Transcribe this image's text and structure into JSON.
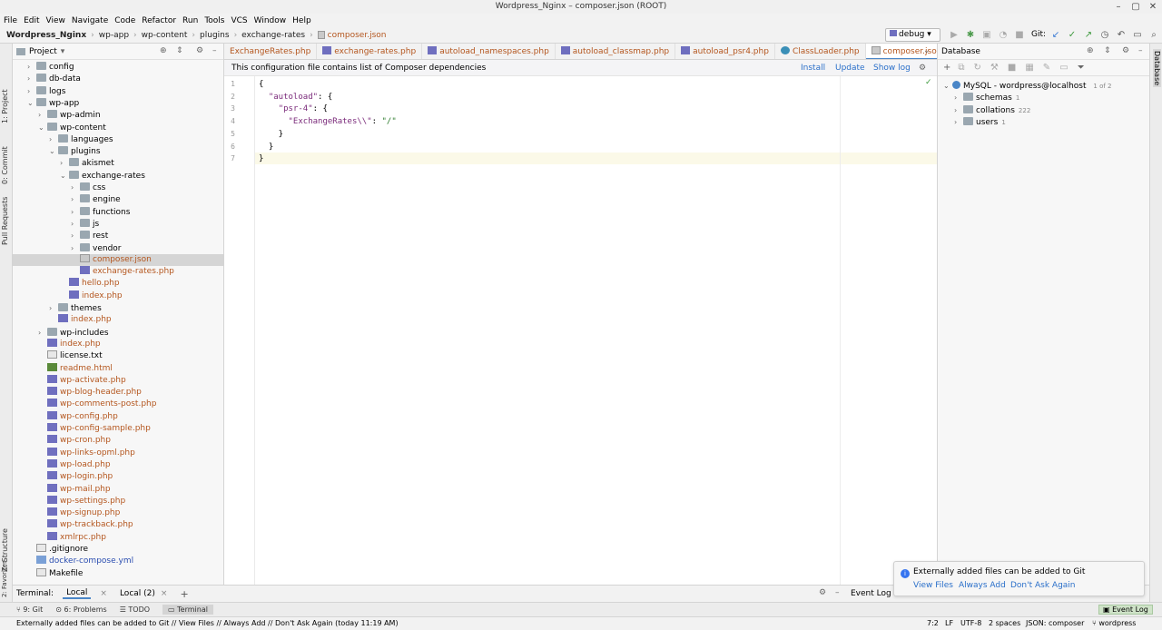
{
  "window": {
    "title": "Wordpress_Nginx – composer.json (ROOT)"
  },
  "menu": [
    "File",
    "Edit",
    "View",
    "Navigate",
    "Code",
    "Refactor",
    "Run",
    "Tools",
    "VCS",
    "Window",
    "Help"
  ],
  "breadcrumb": [
    "Wordpress_Nginx",
    "wp-app",
    "wp-content",
    "plugins",
    "exchange-rates",
    "composer.json"
  ],
  "toolbar": {
    "run_config": "debug",
    "git_label": "Git:"
  },
  "left_tabs": [
    "1: Project",
    "0: Commit",
    "Pull Requests",
    "Z: Structure",
    "2: Favorites"
  ],
  "right_tabs": [
    "Database"
  ],
  "project": {
    "title": "Project",
    "tree": [
      {
        "label": "config",
        "depth": 1,
        "type": "folder",
        "arrow": "›"
      },
      {
        "label": "db-data",
        "depth": 1,
        "type": "folder",
        "arrow": "›"
      },
      {
        "label": "logs",
        "depth": 1,
        "type": "folder",
        "arrow": "›"
      },
      {
        "label": "wp-app",
        "depth": 1,
        "type": "folder",
        "arrow": "⌄"
      },
      {
        "label": "wp-admin",
        "depth": 2,
        "type": "folder",
        "arrow": "›"
      },
      {
        "label": "wp-content",
        "depth": 2,
        "type": "folder",
        "arrow": "⌄"
      },
      {
        "label": "languages",
        "depth": 3,
        "type": "folder",
        "arrow": "›"
      },
      {
        "label": "plugins",
        "depth": 3,
        "type": "folder",
        "arrow": "⌄"
      },
      {
        "label": "akismet",
        "depth": 4,
        "type": "folder",
        "arrow": "›"
      },
      {
        "label": "exchange-rates",
        "depth": 4,
        "type": "folder",
        "arrow": "⌄"
      },
      {
        "label": "css",
        "depth": 5,
        "type": "folder",
        "arrow": "›"
      },
      {
        "label": "engine",
        "depth": 5,
        "type": "folder",
        "arrow": "›"
      },
      {
        "label": "functions",
        "depth": 5,
        "type": "folder",
        "arrow": "›"
      },
      {
        "label": "js",
        "depth": 5,
        "type": "folder",
        "arrow": "›"
      },
      {
        "label": "rest",
        "depth": 5,
        "type": "folder",
        "arrow": "›"
      },
      {
        "label": "vendor",
        "depth": 5,
        "type": "folder",
        "arrow": "›"
      },
      {
        "label": "composer.json",
        "depth": 5,
        "type": "json",
        "arrow": "",
        "selected": true
      },
      {
        "label": "exchange-rates.php",
        "depth": 5,
        "type": "php",
        "arrow": ""
      },
      {
        "label": "hello.php",
        "depth": 4,
        "type": "php",
        "arrow": ""
      },
      {
        "label": "index.php",
        "depth": 4,
        "type": "php",
        "arrow": ""
      },
      {
        "label": "themes",
        "depth": 3,
        "type": "folder",
        "arrow": "›"
      },
      {
        "label": "index.php",
        "depth": 3,
        "type": "php",
        "arrow": ""
      },
      {
        "label": "wp-includes",
        "depth": 2,
        "type": "folder",
        "arrow": "›"
      },
      {
        "label": "index.php",
        "depth": 2,
        "type": "php",
        "arrow": ""
      },
      {
        "label": "license.txt",
        "depth": 2,
        "type": "txt",
        "arrow": ""
      },
      {
        "label": "readme.html",
        "depth": 2,
        "type": "html",
        "arrow": ""
      },
      {
        "label": "wp-activate.php",
        "depth": 2,
        "type": "php",
        "arrow": ""
      },
      {
        "label": "wp-blog-header.php",
        "depth": 2,
        "type": "php",
        "arrow": ""
      },
      {
        "label": "wp-comments-post.php",
        "depth": 2,
        "type": "php",
        "arrow": ""
      },
      {
        "label": "wp-config.php",
        "depth": 2,
        "type": "php",
        "arrow": ""
      },
      {
        "label": "wp-config-sample.php",
        "depth": 2,
        "type": "php",
        "arrow": ""
      },
      {
        "label": "wp-cron.php",
        "depth": 2,
        "type": "php",
        "arrow": ""
      },
      {
        "label": "wp-links-opml.php",
        "depth": 2,
        "type": "php",
        "arrow": ""
      },
      {
        "label": "wp-load.php",
        "depth": 2,
        "type": "php",
        "arrow": ""
      },
      {
        "label": "wp-login.php",
        "depth": 2,
        "type": "php",
        "arrow": ""
      },
      {
        "label": "wp-mail.php",
        "depth": 2,
        "type": "php",
        "arrow": ""
      },
      {
        "label": "wp-settings.php",
        "depth": 2,
        "type": "php",
        "arrow": ""
      },
      {
        "label": "wp-signup.php",
        "depth": 2,
        "type": "php",
        "arrow": ""
      },
      {
        "label": "wp-trackback.php",
        "depth": 2,
        "type": "php",
        "arrow": ""
      },
      {
        "label": "xmlrpc.php",
        "depth": 2,
        "type": "php",
        "arrow": ""
      },
      {
        "label": ".gitignore",
        "depth": 1,
        "type": "txt",
        "arrow": ""
      },
      {
        "label": "docker-compose.yml",
        "depth": 1,
        "type": "yml",
        "arrow": ""
      },
      {
        "label": "Makefile",
        "depth": 1,
        "type": "txt",
        "arrow": ""
      }
    ]
  },
  "editor_tabs": [
    {
      "label": "ExchangeRates.php",
      "active": false
    },
    {
      "label": "exchange-rates.php",
      "active": false
    },
    {
      "label": "autoload_namespaces.php",
      "active": false
    },
    {
      "label": "autoload_classmap.php",
      "active": false
    },
    {
      "label": "autoload_psr4.php",
      "active": false
    },
    {
      "label": "ClassLoader.php",
      "active": false
    },
    {
      "label": "composer.json",
      "active": true
    }
  ],
  "info_bar": {
    "text": "This configuration file contains list of Composer dependencies",
    "install": "Install",
    "update": "Update",
    "show_log": "Show log"
  },
  "code": [
    {
      "n": "1",
      "text": "{"
    },
    {
      "n": "2",
      "text": "  \"autoload\": {"
    },
    {
      "n": "3",
      "text": "    \"psr-4\": {"
    },
    {
      "n": "4",
      "text": "      \"ExchangeRates\\\\\": \"/\""
    },
    {
      "n": "5",
      "text": "    }"
    },
    {
      "n": "6",
      "text": "  }"
    },
    {
      "n": "7",
      "text": "}"
    }
  ],
  "database": {
    "title": "Database",
    "connection": "MySQL - wordpress@localhost",
    "connection_count": "1 of 2",
    "items": [
      {
        "label": "schemas",
        "count": "1"
      },
      {
        "label": "collations",
        "count": "222"
      },
      {
        "label": "users",
        "count": "1"
      }
    ]
  },
  "bottom_panel": {
    "terminal_label": "Terminal:",
    "tabs": [
      "Local",
      "Local (2)"
    ],
    "event_log": "Event Log"
  },
  "bottom_tabs": [
    "9: Git",
    "6: Problems",
    "TODO",
    "Terminal"
  ],
  "bottom_right": "Event Log",
  "notification": {
    "text": "Externally added files can be added to Git",
    "actions": [
      "View Files",
      "Always Add",
      "Don't Ask Again"
    ]
  },
  "status": {
    "message": "Externally added files can be added to Git // View Files // Always Add // Don't Ask Again (today 11:19 AM)",
    "position": "7:2",
    "line_sep": "LF",
    "encoding": "UTF-8",
    "indent": "2 spaces",
    "schema": "JSON: composer",
    "branch": "wordpress"
  }
}
